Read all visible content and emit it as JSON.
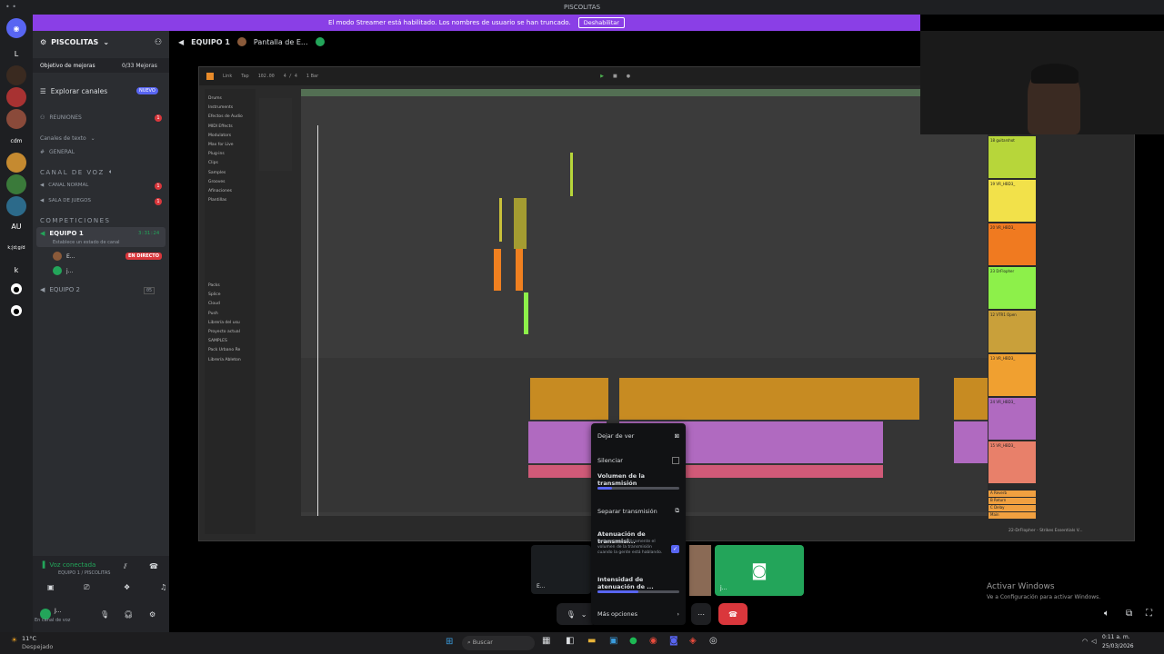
{
  "titlebar": {
    "title": "PISCOLITAS"
  },
  "banner": {
    "text": "El modo Streamer está habilitado. Los nombres de usuario se han truncado.",
    "button": "Deshabilitar"
  },
  "servers": {
    "labels": [
      "L",
      "cdm",
      "AU",
      "k;|d;g/d",
      "k"
    ]
  },
  "server_header": {
    "name": "PISCOLITAS"
  },
  "goal": {
    "label": "Objetivo de mejoras",
    "value": "0/33 Mejoras"
  },
  "explore": {
    "label": "Explorar canales",
    "badge": "NUEVO"
  },
  "channels": {
    "reuniones": "REUNIONES",
    "text_category": "Canales de texto",
    "general": "GENERAL",
    "voice_category": "CANAL DE VOZ",
    "canal_normal": "CANAL NORMAL",
    "sala_juegos": "SALA DE JUEGOS",
    "competitions_category": "COMPETICIONES",
    "equipo1": "EQUIPO 1",
    "equipo1_time": "3:31:24",
    "equipo1_status": "Establece un estado de canal",
    "user1": "E...",
    "live_badge": "EN DIRECTO",
    "user2": "j...",
    "equipo2": "EQUIPO 2",
    "equipo2_count": "05"
  },
  "voice": {
    "status": "Voz conectada",
    "channel": "EQUIPO 1 / PISCOLITAS"
  },
  "user_panel": {
    "name": "J...",
    "status": "En canal de voz"
  },
  "topbar": {
    "channel": "EQUIPO 1",
    "stream": "Pantalla de E..."
  },
  "menu": {
    "stop_watching": "Dejar de ver",
    "mute": "Silenciar",
    "stream_volume": "Volumen de la transmisión",
    "stream_volume_level": 0.18,
    "popout": "Separar transmisión",
    "attenuation": "Atenuación de transmisi...",
    "attenuation_desc": "Reduce automáticamente el volumen de la transmisión cuando la gente está hablando.",
    "attenuation_intensity": "Intensidad de atenuación de ...",
    "attenuation_level": 0.5,
    "more": "Más opciones"
  },
  "tiles": {
    "small_label": "E...",
    "discord_label": "j..."
  },
  "activation": {
    "title": "Activar Windows",
    "sub": "Ve a Configuración para activar Windows."
  },
  "taskbar": {
    "weather_temp": "11°C",
    "weather_desc": "Despejado",
    "search": "Buscar",
    "time": "0:11 a. m.",
    "date": "25/03/2026"
  },
  "daw": {
    "top": [
      "Link",
      "Tap",
      "102.00",
      "4 / 4",
      "1 Bar"
    ],
    "browser": [
      "Drums",
      "Instruments",
      "Efectos de Audio",
      "MIDI Effects",
      "Modulators",
      "Max for Live",
      "Plug-ins",
      "Clips",
      "Samples",
      "Grooves",
      "Afinaciones",
      "Plantillas"
    ],
    "places": [
      "Packs",
      "Splice",
      "Cloud",
      "Push",
      "Librería del usu",
      "Proyecto actual",
      "SAMPLES",
      "Pack Urbano Re",
      "Librería Ableton"
    ],
    "tracks": [
      "18 guitarshot",
      "19 VR_HBD3_",
      "20 VR_HBD3_",
      "23 DrFlopher",
      "12 VTR1 Open",
      "13 VR_HBD3_",
      "24 VR_HBD3_",
      "15 VR_HBD3_"
    ],
    "returns": [
      "A Reverb",
      "B Return",
      "C Delay",
      "Main"
    ],
    "status": "22-DrFlopher - Strikes Essentials V..."
  }
}
